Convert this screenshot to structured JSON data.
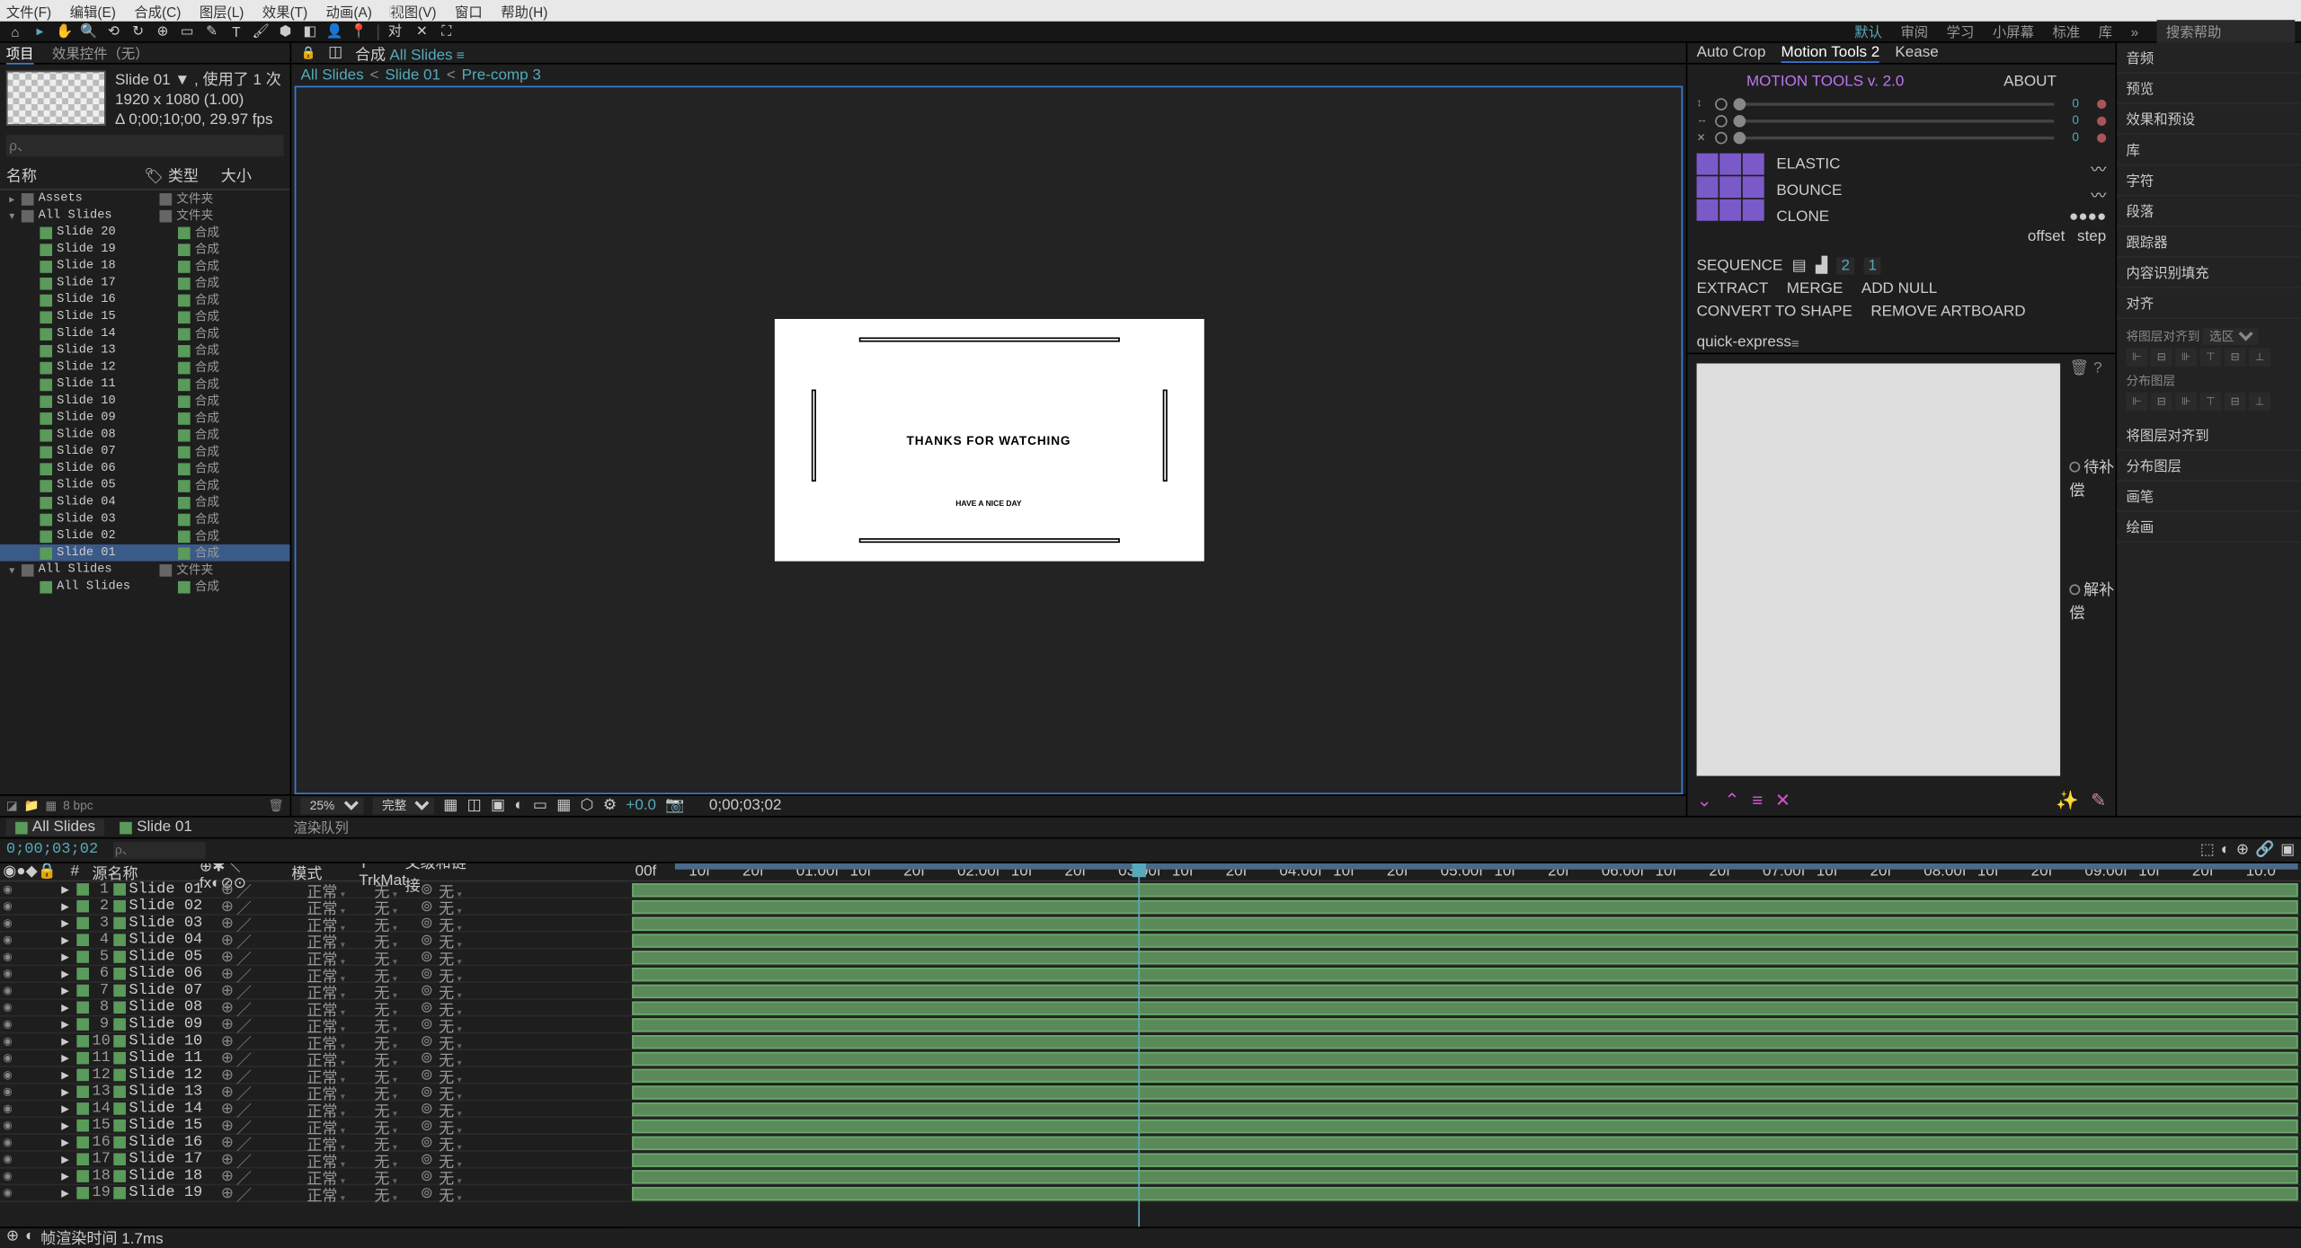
{
  "menu": [
    "文件(F)",
    "编辑(E)",
    "合成(C)",
    "图层(L)",
    "效果(T)",
    "动画(A)",
    "视图(V)",
    "窗口",
    "帮助(H)"
  ],
  "workspace": {
    "items": [
      "默认",
      "审阅",
      "学习",
      "小屏幕",
      "标准",
      "库"
    ],
    "search": "搜索帮助"
  },
  "project": {
    "tabs": [
      "项目",
      "效果控件（无）"
    ],
    "thumb": {
      "name": "Slide 01",
      "used": "使用了 1 次",
      "dim": "1920 x 1080 (1.00)",
      "dur": "Δ 0;00;10;00, 29.97 fps"
    },
    "search": "ρ、",
    "cols": [
      "名称",
      "类型",
      "大小"
    ],
    "items": [
      {
        "d": 0,
        "tw": "▸",
        "c": "folder",
        "n": "Assets",
        "t": "文件夹"
      },
      {
        "d": 0,
        "tw": "▾",
        "c": "folder",
        "n": "All Slides",
        "t": "文件夹"
      },
      {
        "d": 1,
        "tw": "",
        "c": "comp",
        "n": "Slide 20",
        "t": "合成"
      },
      {
        "d": 1,
        "tw": "",
        "c": "comp",
        "n": "Slide 19",
        "t": "合成"
      },
      {
        "d": 1,
        "tw": "",
        "c": "comp",
        "n": "Slide 18",
        "t": "合成"
      },
      {
        "d": 1,
        "tw": "",
        "c": "comp",
        "n": "Slide 17",
        "t": "合成"
      },
      {
        "d": 1,
        "tw": "",
        "c": "comp",
        "n": "Slide 16",
        "t": "合成"
      },
      {
        "d": 1,
        "tw": "",
        "c": "comp",
        "n": "Slide 15",
        "t": "合成"
      },
      {
        "d": 1,
        "tw": "",
        "c": "comp",
        "n": "Slide 14",
        "t": "合成"
      },
      {
        "d": 1,
        "tw": "",
        "c": "comp",
        "n": "Slide 13",
        "t": "合成"
      },
      {
        "d": 1,
        "tw": "",
        "c": "comp",
        "n": "Slide 12",
        "t": "合成"
      },
      {
        "d": 1,
        "tw": "",
        "c": "comp",
        "n": "Slide 11",
        "t": "合成"
      },
      {
        "d": 1,
        "tw": "",
        "c": "comp",
        "n": "Slide 10",
        "t": "合成"
      },
      {
        "d": 1,
        "tw": "",
        "c": "comp",
        "n": "Slide 09",
        "t": "合成"
      },
      {
        "d": 1,
        "tw": "",
        "c": "comp",
        "n": "Slide 08",
        "t": "合成"
      },
      {
        "d": 1,
        "tw": "",
        "c": "comp",
        "n": "Slide 07",
        "t": "合成"
      },
      {
        "d": 1,
        "tw": "",
        "c": "comp",
        "n": "Slide 06",
        "t": "合成"
      },
      {
        "d": 1,
        "tw": "",
        "c": "comp",
        "n": "Slide 05",
        "t": "合成"
      },
      {
        "d": 1,
        "tw": "",
        "c": "comp",
        "n": "Slide 04",
        "t": "合成"
      },
      {
        "d": 1,
        "tw": "",
        "c": "comp",
        "n": "Slide 03",
        "t": "合成"
      },
      {
        "d": 1,
        "tw": "",
        "c": "comp",
        "n": "Slide 02",
        "t": "合成"
      },
      {
        "d": 1,
        "tw": "",
        "c": "comp",
        "n": "Slide 01",
        "t": "合成",
        "sel": true
      },
      {
        "d": 0,
        "tw": "▾",
        "c": "folder",
        "n": "All Slides",
        "t": "文件夹"
      },
      {
        "d": 1,
        "tw": "",
        "c": "comp",
        "n": "All Slides",
        "t": "合成"
      }
    ],
    "foot": {
      "bpc": "8 bpc"
    }
  },
  "comp": {
    "tab": "合成",
    "name": "All Slides",
    "crumbs": [
      "All Slides",
      "Slide 01",
      "Pre-comp 3"
    ],
    "slide": {
      "t1": "THANKS FOR WATCHING",
      "t2": "HAVE A NICE DAY"
    },
    "foot": {
      "zoom": "25%",
      "res": "完整",
      "exp": "+0.0",
      "tc": "0;00;03;02"
    }
  },
  "mtools": {
    "tabs": [
      "Auto Crop",
      "Motion Tools 2",
      "Kease"
    ],
    "hdr": [
      "MOTION TOOLS v. 2.0",
      "ABOUT"
    ],
    "axes": [
      {
        "l": "↕",
        "v": "0"
      },
      {
        "l": "↔",
        "v": "0"
      },
      {
        "l": "✕",
        "v": "0"
      }
    ],
    "opts": [
      "ELASTIC",
      "BOUNCE",
      "CLONE"
    ],
    "seq": {
      "l": "SEQUENCE",
      "offset": "offset",
      "step": "step",
      "v1": "2",
      "v2": "1"
    },
    "btns": [
      "EXTRACT",
      "MERGE",
      "ADD NULL"
    ],
    "btns2": [
      "CONVERT TO SHAPE",
      "REMOVE ARTBOARD"
    ]
  },
  "qe": {
    "title": "quick-express",
    "opts": [
      "待补偿",
      "解补偿"
    ]
  },
  "rside": [
    "音频",
    "预览",
    "效果和预设",
    "库",
    "字符",
    "段落",
    "跟踪器",
    "内容识别填充",
    "对齐",
    "将图层对齐到",
    "分布图层",
    "画笔",
    "绘画"
  ],
  "timeline": {
    "tabs": [
      {
        "n": "All Slides",
        "a": true
      },
      {
        "n": "Slide 01"
      }
    ],
    "render": "渲染队列",
    "tc": "0;00;03;02",
    "hdr": {
      "src": "源名称",
      "mode": "模式",
      "trk": "T TrkMat",
      "par": "父级和链接"
    },
    "layers": [
      {
        "i": 1,
        "n": "Slide 01"
      },
      {
        "i": 2,
        "n": "Slide 02"
      },
      {
        "i": 3,
        "n": "Slide 03"
      },
      {
        "i": 4,
        "n": "Slide 04"
      },
      {
        "i": 5,
        "n": "Slide 05"
      },
      {
        "i": 6,
        "n": "Slide 06"
      },
      {
        "i": 7,
        "n": "Slide 07"
      },
      {
        "i": 8,
        "n": "Slide 08"
      },
      {
        "i": 9,
        "n": "Slide 09"
      },
      {
        "i": 10,
        "n": "Slide 10"
      },
      {
        "i": 11,
        "n": "Slide 11"
      },
      {
        "i": 12,
        "n": "Slide 12"
      },
      {
        "i": 13,
        "n": "Slide 13"
      },
      {
        "i": 14,
        "n": "Slide 14"
      },
      {
        "i": 15,
        "n": "Slide 15"
      },
      {
        "i": 16,
        "n": "Slide 16"
      },
      {
        "i": 17,
        "n": "Slide 17"
      },
      {
        "i": 18,
        "n": "Slide 18"
      },
      {
        "i": 19,
        "n": "Slide 19"
      }
    ],
    "mode": "正常",
    "trk": "无",
    "par": "无",
    "ruler": [
      "00f",
      "10f",
      "20f",
      "01:00f",
      "10f",
      "20f",
      "02:00f",
      "10f",
      "20f",
      "03:00f",
      "10f",
      "20f",
      "04:00f",
      "10f",
      "20f",
      "05:00f",
      "10f",
      "20f",
      "06:00f",
      "10f",
      "20f",
      "07:00f",
      "10f",
      "20f",
      "08:00f",
      "10f",
      "20f",
      "09:00f",
      "10f",
      "20f",
      "10:0"
    ],
    "foot": "帧渲染时间 1.7ms"
  }
}
